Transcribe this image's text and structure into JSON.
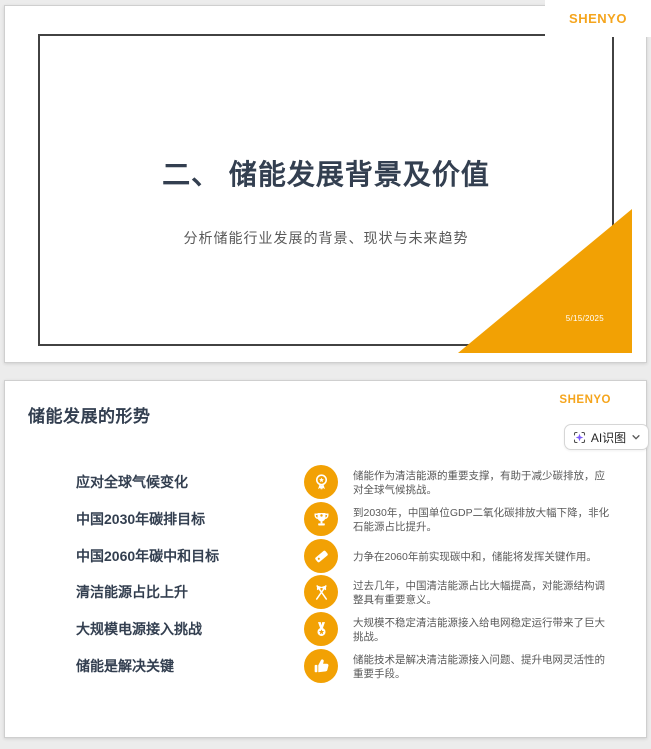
{
  "colors": {
    "accent_orange": "#F2A104",
    "brand_orange": "#F5A51D",
    "title_navy": "#333F50",
    "body_gray": "#595959",
    "sparkle_purple": "#7C5CFA"
  },
  "slide1": {
    "logo": "SHENYO",
    "title": "二、 储能发展背景及价值",
    "subtitle": "分析储能行业发展的背景、现状与未来趋势",
    "date": "5/15/2025"
  },
  "slide2": {
    "logo": "SHENYO",
    "title": "储能发展的形势",
    "ai_button": {
      "label": "AI识图"
    },
    "rows": [
      {
        "label": "应对全球气候变化",
        "icon": "award-ribbon-icon",
        "desc": "储能作为清洁能源的重要支撑，有助于减少碳排放，应对全球气候挑战。"
      },
      {
        "label": "中国2030年碳排目标",
        "icon": "trophy-icon",
        "desc": "到2030年，中国单位GDP二氧化碳排放大幅下降，非化石能源占比提升。"
      },
      {
        "label": "中国2060年碳中和目标",
        "icon": "price-tag-icon",
        "desc": "力争在2060年前实现碳中和，储能将发挥关键作用。"
      },
      {
        "label": "清洁能源占比上升",
        "icon": "crossed-flags-icon",
        "desc": "过去几年，中国清洁能源占比大幅提高，对能源结构调整具有重要意义。"
      },
      {
        "label": "大规模电源接入挑战",
        "icon": "medal-star-icon",
        "desc": "大规模不稳定清洁能源接入给电网稳定运行带来了巨大挑战。"
      },
      {
        "label": "储能是解决关键",
        "icon": "thumbs-up-icon",
        "desc": "储能技术是解决清洁能源接入问题、提升电网灵活性的重要手段。"
      }
    ]
  }
}
